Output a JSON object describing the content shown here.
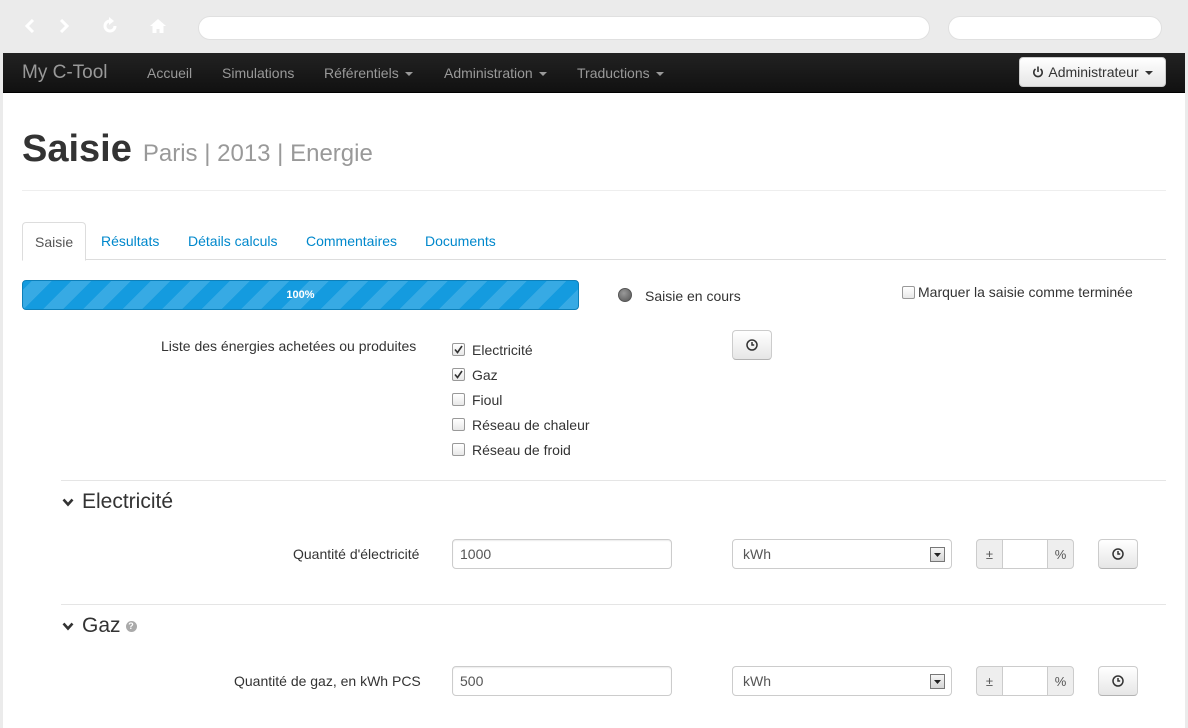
{
  "navbar": {
    "brand": "My C-Tool",
    "items": [
      "Accueil",
      "Simulations",
      "Référentiels",
      "Administration",
      "Traductions"
    ],
    "user_label": "Administrateur"
  },
  "page": {
    "title": "Saisie",
    "subtitle": "Paris | 2013 | Energie"
  },
  "tabs": [
    "Saisie",
    "Résultats",
    "Détails calculs",
    "Commentaires",
    "Documents"
  ],
  "progress": {
    "value": 1.0,
    "label": "100%",
    "status_text": "Saisie en cours",
    "mark_complete_label": "Marquer la saisie comme terminée",
    "mark_complete_checked": false
  },
  "energies": {
    "label": "Liste des énergies achetées ou produites",
    "options": [
      {
        "label": "Electricité",
        "checked": true
      },
      {
        "label": "Gaz",
        "checked": true
      },
      {
        "label": "Fioul",
        "checked": false
      },
      {
        "label": "Réseau de chaleur",
        "checked": false
      },
      {
        "label": "Réseau de froid",
        "checked": false
      }
    ]
  },
  "sections": {
    "electricite": {
      "title": "Electricité",
      "field_label": "Quantité d'électricité",
      "value": "1000",
      "unit": "kWh",
      "plusminus": "±",
      "percent": "%"
    },
    "gaz": {
      "title": "Gaz",
      "help": "?",
      "field_label": "Quantité de gaz, en kWh PCS",
      "value": "500",
      "unit": "kWh",
      "plusminus": "±",
      "percent": "%"
    }
  }
}
